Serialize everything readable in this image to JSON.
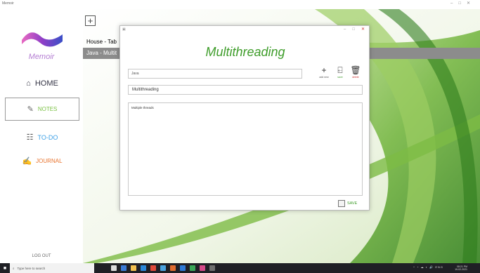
{
  "app": {
    "title": "Memoir"
  },
  "sidebar": {
    "logo_text": "Memoir",
    "home": "HOME",
    "notes": "NOTES",
    "todo": "TO-DO",
    "journal": "JOURNAL",
    "logout": "LOG OUT"
  },
  "notes_list": {
    "add_symbol": "+",
    "items": [
      {
        "label": "House - Tab"
      },
      {
        "label": "Java - Multit"
      }
    ]
  },
  "dialog": {
    "title": "Multithreading",
    "category_value": "Java",
    "note_title_value": "Multithreading",
    "body_value": "Multiple threads",
    "tools": {
      "add": "add new",
      "save": "save",
      "delete": "delete"
    },
    "save_label": "SAVE"
  },
  "taskbar": {
    "search_placeholder": "Type here to search",
    "time": "08:21 PM",
    "date": "19-02-2021",
    "lang": "ENG"
  },
  "colors": {
    "accent_green": "#3f9d2b",
    "selected_gray": "#8c8c8c",
    "logo_purple": "#b57fd3"
  }
}
